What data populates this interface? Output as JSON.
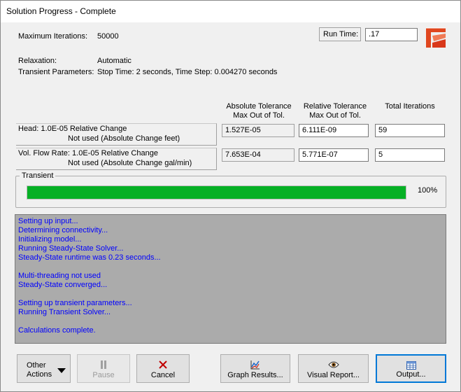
{
  "window": {
    "title": "Solution Progress - Complete"
  },
  "summary": {
    "max_iterations_label": "Maximum Iterations:",
    "max_iterations_value": "50000",
    "run_time_label": "Run Time:",
    "run_time_value": ".17",
    "relaxation_label": "Relaxation:",
    "relaxation_value": "Automatic",
    "transient_label": "Transient Parameters:",
    "transient_value": "Stop Time: 2 seconds, Time Step: 0.004270 seconds"
  },
  "tolerance_table": {
    "columns": [
      {
        "line1": "Absolute Tolerance",
        "line2": "Max Out of Tol."
      },
      {
        "line1": "Relative Tolerance",
        "line2": "Max Out of Tol."
      },
      {
        "line1": "Total Iterations",
        "line2": ""
      }
    ],
    "rows": [
      {
        "label1": "Head: 1.0E-05 Relative Change",
        "label2": "Not used (Absolute Change feet)",
        "absolute": "1.527E-05",
        "relative": "6.111E-09",
        "iterations": "59"
      },
      {
        "label1": "Vol. Flow Rate: 1.0E-05 Relative Change",
        "label2": "Not used (Absolute Change gal/min)",
        "absolute": "7.653E-04",
        "relative": "5.771E-07",
        "iterations": "5"
      }
    ]
  },
  "transient": {
    "group_label": "Transient",
    "progress": 1.0,
    "progress_text": "100%"
  },
  "log_lines": [
    "Setting up input...",
    "Determining connectivity...",
    "Initializing model...",
    "Running Steady-State Solver...",
    "Steady-State runtime was 0.23 seconds...",
    "",
    "Multi-threading not used",
    "Steady-State converged...",
    "",
    "Setting up transient parameters...",
    "Running Transient Solver...",
    "",
    "Calculations complete."
  ],
  "buttons": {
    "other_actions_line1": "Other",
    "other_actions_line2": "Actions",
    "pause": "Pause",
    "cancel": "Cancel",
    "graph_results": "Graph Results...",
    "visual_report": "Visual Report...",
    "output": "Output..."
  },
  "colors": {
    "progress": "#06b025",
    "log_background": "#ababab",
    "log_text": "#0000ff",
    "cancel_icon": "#c00000",
    "default_button_border": "#0078d7"
  },
  "icons": {
    "run_time": "chart-icon",
    "pause": "pause-icon",
    "cancel": "x-icon",
    "graph_results": "graph-icon",
    "visual_report": "eye-icon",
    "output": "table-icon"
  }
}
